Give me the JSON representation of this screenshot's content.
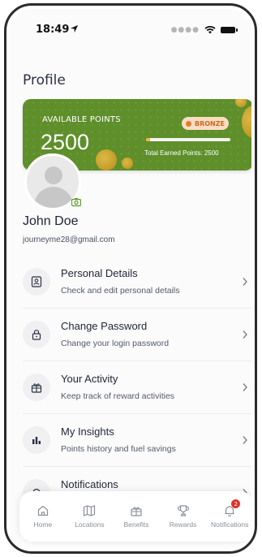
{
  "status_bar": {
    "time": "18:49"
  },
  "header": {
    "title": "Profile"
  },
  "points_card": {
    "available_label": "AVAILABLE POINTS",
    "points": "2500",
    "tier": "BRONZE",
    "total_label": "Total Earned Points: 2500",
    "progress_fraction": 0.05
  },
  "user": {
    "name": "John Doe",
    "email": "journeyme28@gmail.com"
  },
  "menu": [
    {
      "title": "Personal Details",
      "subtitle": "Check and edit personal details",
      "icon": "id-card-icon"
    },
    {
      "title": "Change Password",
      "subtitle": "Change your login password",
      "icon": "lock-icon"
    },
    {
      "title": "Your Activity",
      "subtitle": "Keep track of reward activities",
      "icon": "gift-icon"
    },
    {
      "title": "My Insights",
      "subtitle": "Points history and fuel savings",
      "icon": "bar-chart-icon"
    },
    {
      "title": "Notifications",
      "subtitle": "",
      "icon": "bell-icon"
    }
  ],
  "tabbar": [
    {
      "label": "Home",
      "icon": "home-icon"
    },
    {
      "label": "Locations",
      "icon": "map-icon"
    },
    {
      "label": "Benefits",
      "icon": "gift-icon"
    },
    {
      "label": "Rewards",
      "icon": "trophy-icon"
    },
    {
      "label": "Notifications",
      "icon": "bell-icon",
      "badge": "2"
    }
  ],
  "colors": {
    "card_green": "#5e8f2a",
    "badge_bg": "#f8ddc4",
    "badge_text": "#d06a1c",
    "accent_gold": "#f2b632",
    "notification_red": "#e2332b"
  }
}
